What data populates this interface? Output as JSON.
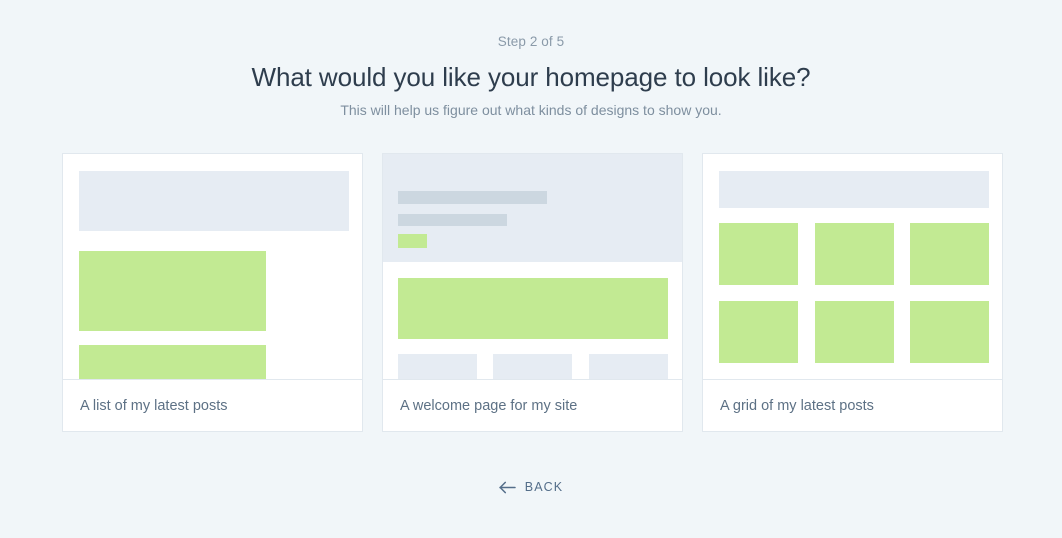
{
  "header": {
    "step_text": "Step 2 of 5",
    "title": "What would you like your homepage to look like?",
    "subtitle": "This will help us figure out what kinds of designs to show you."
  },
  "options": [
    {
      "id": "list-of-latest-posts",
      "label": "A list of my latest posts"
    },
    {
      "id": "welcome-page",
      "label": "A welcome page for my site"
    },
    {
      "id": "grid-of-latest-posts",
      "label": "A grid of my latest posts"
    }
  ],
  "footer": {
    "back_label": "BACK",
    "back_icon": "arrow-left-icon"
  },
  "colors": {
    "page_background": "#f1f6f9",
    "card_background": "#ffffff",
    "card_border": "#e1e8ee",
    "placeholder_light": "#e6ecf3",
    "placeholder_dark": "#ccd7e0",
    "accent_green": "#c2ea93",
    "title_text": "#2e3d4d",
    "muted_text": "#7e8f9f",
    "label_text": "#5d7185",
    "back_text": "#546e8a"
  }
}
